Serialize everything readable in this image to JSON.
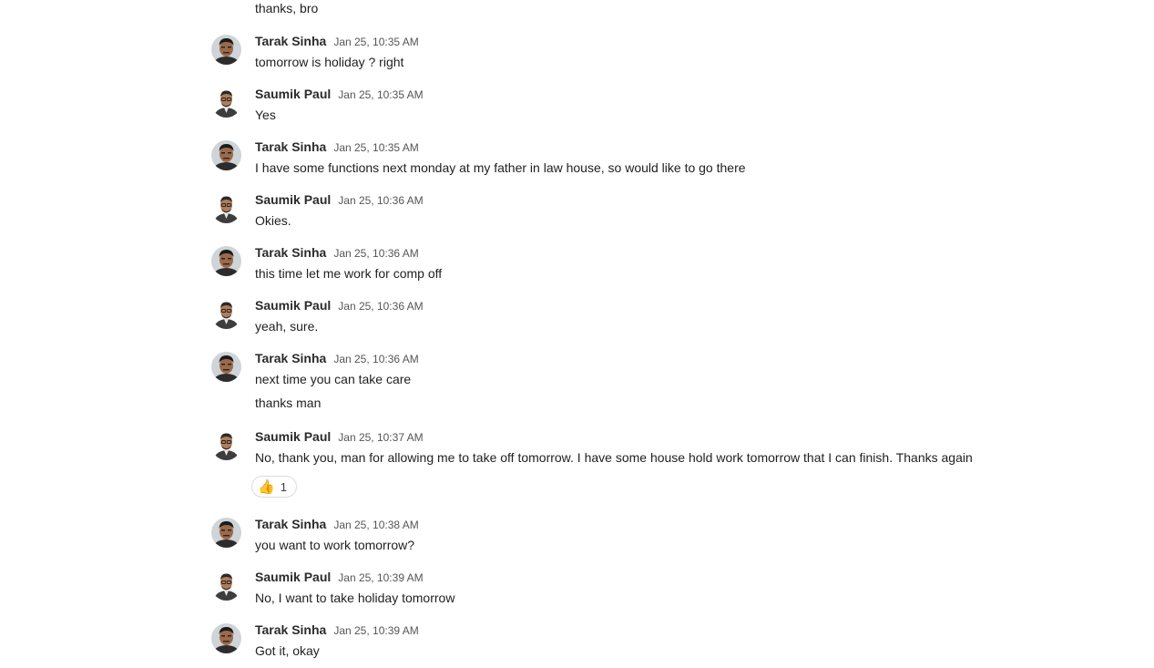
{
  "top_text": "thanks, bro",
  "messages": [
    {
      "author": "Tarak Sinha",
      "time": "Jan 25, 10:35 AM",
      "avatar": "tarak-avatar",
      "lines": [
        "tomorrow is holiday ? right"
      ]
    },
    {
      "author": "Saumik Paul",
      "time": "Jan 25, 10:35 AM",
      "avatar": "saumik-avatar",
      "lines": [
        "Yes"
      ]
    },
    {
      "author": "Tarak Sinha",
      "time": "Jan 25, 10:35 AM",
      "avatar": "tarak-avatar",
      "lines": [
        "I have some functions next monday at my father in law house, so would like to go there"
      ]
    },
    {
      "author": "Saumik Paul",
      "time": "Jan 25, 10:36 AM",
      "avatar": "saumik-avatar",
      "lines": [
        "Okies."
      ]
    },
    {
      "author": "Tarak Sinha",
      "time": "Jan 25, 10:36 AM",
      "avatar": "tarak-avatar",
      "lines": [
        "this time let me work for comp off"
      ]
    },
    {
      "author": "Saumik Paul",
      "time": "Jan 25, 10:36 AM",
      "avatar": "saumik-avatar",
      "lines": [
        "yeah, sure."
      ]
    },
    {
      "author": "Tarak Sinha",
      "time": "Jan 25, 10:36 AM",
      "avatar": "tarak-avatar",
      "lines": [
        "next time you can take care",
        "thanks man"
      ]
    },
    {
      "author": "Saumik Paul",
      "time": "Jan 25, 10:37 AM",
      "avatar": "saumik-avatar",
      "lines": [
        "No, thank you, man for allowing me to take off tomorrow. I have some house hold work tomorrow that I can finish. Thanks again"
      ],
      "reaction": {
        "emoji": "thumbs-up-icon",
        "glyph": "👍",
        "count": "1"
      }
    },
    {
      "author": "Tarak Sinha",
      "time": "Jan 25, 10:38 AM",
      "avatar": "tarak-avatar",
      "lines": [
        "you want to work tomorrow?"
      ]
    },
    {
      "author": "Saumik Paul",
      "time": "Jan 25, 10:39 AM",
      "avatar": "saumik-avatar",
      "lines": [
        "No, I want to take holiday tomorrow"
      ]
    },
    {
      "author": "Tarak Sinha",
      "time": "Jan 25, 10:39 AM",
      "avatar": "tarak-avatar",
      "lines": [
        "Got it, okay"
      ]
    }
  ]
}
